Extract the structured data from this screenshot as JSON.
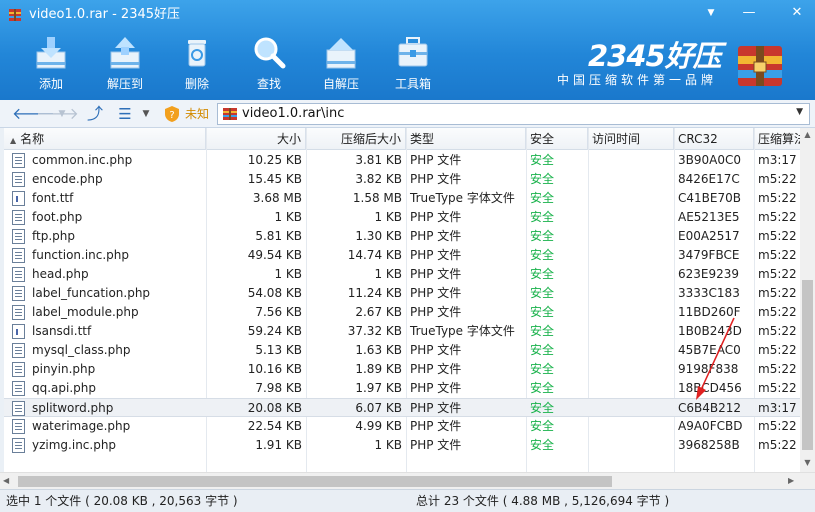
{
  "window": {
    "title": "video1.0.rar - 2345好压",
    "menu_glyph": "▼",
    "minimize_glyph": "—",
    "close_glyph": "✕"
  },
  "toolbar": [
    {
      "label": "添加",
      "icon": "add-archive-icon"
    },
    {
      "label": "解压到",
      "icon": "extract-to-icon"
    },
    {
      "label": "删除",
      "icon": "recycle-bin-icon"
    },
    {
      "label": "查找",
      "icon": "magnifier-icon"
    },
    {
      "label": "自解压",
      "icon": "self-extract-icon"
    },
    {
      "label": "工具箱",
      "icon": "toolbox-icon"
    }
  ],
  "brand": {
    "logo": "2345好压",
    "slogan": "中国压缩软件第一品牌"
  },
  "addressbar": {
    "back_glyph": "🡐",
    "forward_glyph": "🡒",
    "dropdown_glyph": "▼",
    "up_glyph": "⤴",
    "view_glyph": "☰",
    "security_label": "未知",
    "path": "video1.0.rar\\inc"
  },
  "columns": [
    {
      "label": "名称",
      "sort_glyph": "▲"
    },
    {
      "label": "大小"
    },
    {
      "label": "压缩后大小"
    },
    {
      "label": "类型"
    },
    {
      "label": "安全"
    },
    {
      "label": "访问时间"
    },
    {
      "label": "CRC32"
    },
    {
      "label": "压缩算法"
    }
  ],
  "files": [
    {
      "name": "common.inc.php",
      "size": "10.25 KB",
      "packed": "3.81 KB",
      "type": "PHP 文件",
      "safety": "安全",
      "accessed": "",
      "crc": "3B90A0C0",
      "method": "m3:17",
      "kind": "php"
    },
    {
      "name": "encode.php",
      "size": "15.45 KB",
      "packed": "3.82 KB",
      "type": "PHP 文件",
      "safety": "安全",
      "accessed": "",
      "crc": "8426E17C",
      "method": "m5:22",
      "kind": "php"
    },
    {
      "name": "font.ttf",
      "size": "3.68 MB",
      "packed": "1.58 MB",
      "type": "TrueType 字体文件",
      "safety": "安全",
      "accessed": "",
      "crc": "C41BE70B",
      "method": "m5:22",
      "kind": "ttf"
    },
    {
      "name": "foot.php",
      "size": "1 KB",
      "packed": "1 KB",
      "type": "PHP 文件",
      "safety": "安全",
      "accessed": "",
      "crc": "AE5213E5",
      "method": "m5:22",
      "kind": "php"
    },
    {
      "name": "ftp.php",
      "size": "5.81 KB",
      "packed": "1.30 KB",
      "type": "PHP 文件",
      "safety": "安全",
      "accessed": "",
      "crc": "E00A2517",
      "method": "m5:22",
      "kind": "php"
    },
    {
      "name": "function.inc.php",
      "size": "49.54 KB",
      "packed": "14.74 KB",
      "type": "PHP 文件",
      "safety": "安全",
      "accessed": "",
      "crc": "3479FBCE",
      "method": "m5:22",
      "kind": "php"
    },
    {
      "name": "head.php",
      "size": "1 KB",
      "packed": "1 KB",
      "type": "PHP 文件",
      "safety": "安全",
      "accessed": "",
      "crc": "623E9239",
      "method": "m5:22",
      "kind": "php"
    },
    {
      "name": "label_funcation.php",
      "size": "54.08 KB",
      "packed": "11.24 KB",
      "type": "PHP 文件",
      "safety": "安全",
      "accessed": "",
      "crc": "3333C183",
      "method": "m5:22",
      "kind": "php"
    },
    {
      "name": "label_module.php",
      "size": "7.56 KB",
      "packed": "2.67 KB",
      "type": "PHP 文件",
      "safety": "安全",
      "accessed": "",
      "crc": "11BD260F",
      "method": "m5:22",
      "kind": "php"
    },
    {
      "name": "lsansdi.ttf",
      "size": "59.24 KB",
      "packed": "37.32 KB",
      "type": "TrueType 字体文件",
      "safety": "安全",
      "accessed": "",
      "crc": "1B0B243D",
      "method": "m5:22",
      "kind": "ttf"
    },
    {
      "name": "mysql_class.php",
      "size": "5.13 KB",
      "packed": "1.63 KB",
      "type": "PHP 文件",
      "safety": "安全",
      "accessed": "",
      "crc": "45B7EAC0",
      "method": "m5:22",
      "kind": "php"
    },
    {
      "name": "pinyin.php",
      "size": "10.16 KB",
      "packed": "1.89 KB",
      "type": "PHP 文件",
      "safety": "安全",
      "accessed": "",
      "crc": "9198F838",
      "method": "m5:22",
      "kind": "php"
    },
    {
      "name": "qq.api.php",
      "size": "7.98 KB",
      "packed": "1.97 KB",
      "type": "PHP 文件",
      "safety": "安全",
      "accessed": "",
      "crc": "18BCD456",
      "method": "m5:22",
      "kind": "php"
    },
    {
      "name": "splitword.php",
      "size": "20.08 KB",
      "packed": "6.07 KB",
      "type": "PHP 文件",
      "safety": "安全",
      "accessed": "",
      "crc": "C6B4B212",
      "method": "m3:17",
      "kind": "php",
      "selected": true
    },
    {
      "name": "waterimage.php",
      "size": "22.54 KB",
      "packed": "4.99 KB",
      "type": "PHP 文件",
      "safety": "安全",
      "accessed": "",
      "crc": "A9A0FCBD",
      "method": "m5:22",
      "kind": "php"
    },
    {
      "name": "yzimg.inc.php",
      "size": "1.91 KB",
      "packed": "1 KB",
      "type": "PHP 文件",
      "safety": "安全",
      "accessed": "",
      "crc": "3968258B",
      "method": "m5:22",
      "kind": "php"
    }
  ],
  "status": {
    "selection": "选中 1 个文件 ( 20.08 KB , 20,563 字节 )",
    "total": "总计 23 个文件 ( 4.88 MB , 5,126,694 字节 )"
  },
  "colors": {
    "toolbar_blue": "#2286d8",
    "safe_green": "#19b24b",
    "annotation_red": "#e02020"
  }
}
